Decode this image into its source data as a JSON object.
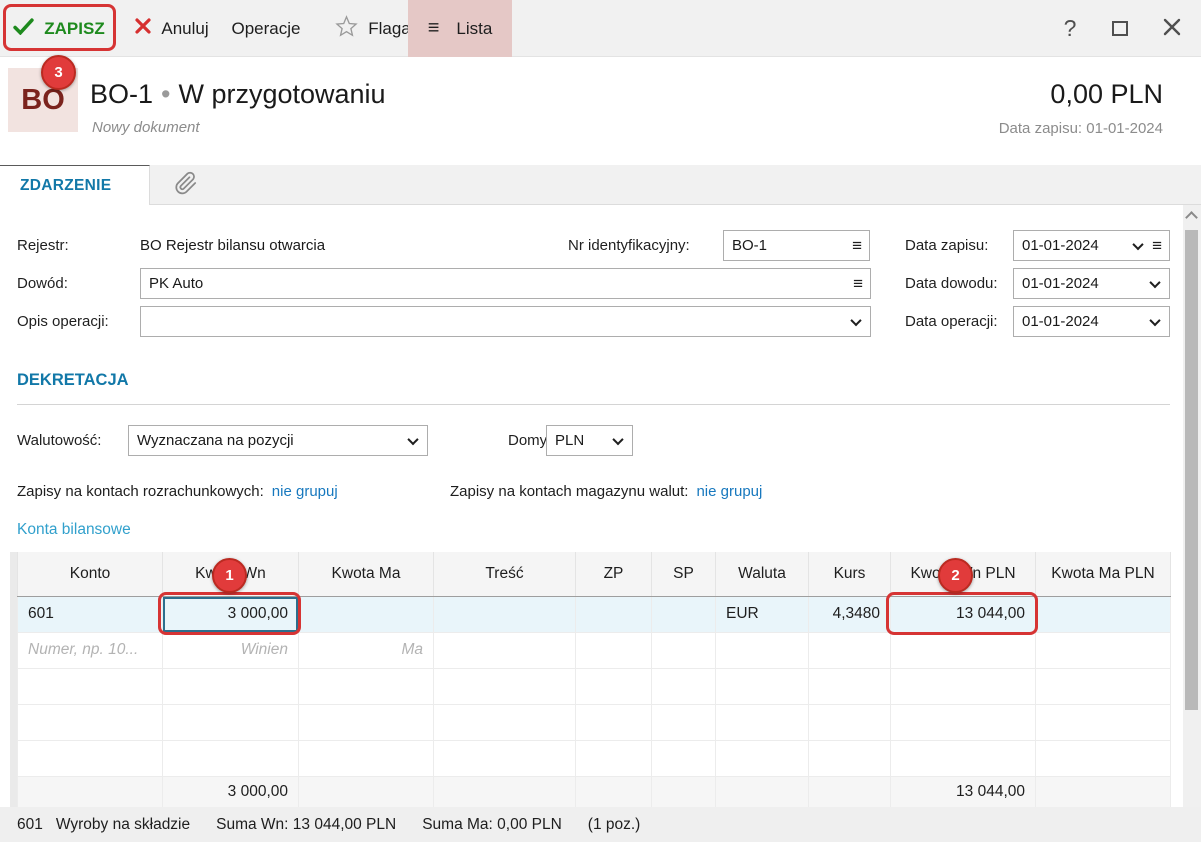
{
  "toolbar": {
    "zapisz": "ZAPISZ",
    "anuluj": "Anuluj",
    "operacje": "Operacje",
    "flaga": "Flaga",
    "lista": "Lista",
    "help": "?"
  },
  "header": {
    "badge": "BO",
    "doc_number": "BO-1",
    "separator": "•",
    "status": "W przygotowaniu",
    "subtitle": "Nowy dokument",
    "amount": "0,00 PLN",
    "save_date": "Data zapisu: 01-01-2024"
  },
  "tabs": {
    "zdarzenie": "ZDARZENIE"
  },
  "form": {
    "rejestr": {
      "label": "Rejestr:",
      "value": "BO Rejestr bilansu otwarcia"
    },
    "nr_identyfikacyjny": {
      "label": "Nr identyfikacyjny:",
      "value": "BO-1"
    },
    "data_zapisu": {
      "label": "Data zapisu:",
      "value": "01-01-2024"
    },
    "dowod": {
      "label": "Dowód:",
      "value": "PK Auto"
    },
    "data_dowodu": {
      "label": "Data dowodu:",
      "value": "01-01-2024"
    },
    "opis_operacji": {
      "label": "Opis operacji:",
      "value": ""
    },
    "data_operacji": {
      "label": "Data operacji:",
      "value": "01-01-2024"
    }
  },
  "dekretacja": {
    "title": "DEKRETACJA",
    "walutowosc": {
      "label": "Walutowość:",
      "value": "Wyznaczana na pozycji"
    },
    "domyslnie": {
      "label": "Domyślnie:",
      "value": "PLN"
    },
    "rozrachunkowe": {
      "label": "Zapisy na kontach rozrachunkowych:",
      "link": "nie grupuj"
    },
    "magazyn_walut": {
      "label": "Zapisy na kontach magazynu walut:",
      "link": "nie grupuj"
    },
    "konta_bilansowe": "Konta bilansowe"
  },
  "grid": {
    "columns": [
      "Konto",
      "Kwota Wn",
      "Kwota Ma",
      "Treść",
      "ZP",
      "SP",
      "Waluta",
      "Kurs",
      "Kwota Wn PLN",
      "Kwota Ma PLN"
    ],
    "row1": {
      "konto": "601",
      "kwota_wn": "3 000,00",
      "kwota_ma": "",
      "tresc": "",
      "zp": "",
      "sp": "",
      "waluta": "EUR",
      "kurs": "4,3480",
      "kwota_wn_pln": "13 044,00",
      "kwota_ma_pln": ""
    },
    "placeholder_row": {
      "konto": "Numer, np. 10...",
      "kwota_wn": "Winien",
      "kwota_ma": "Ma"
    },
    "sum_row": {
      "kwota_wn": "3 000,00",
      "kwota_wn_pln": "13 044,00"
    }
  },
  "statusbar": {
    "konto": "601",
    "konto_name": "Wyroby na składzie",
    "suma_wn": "Suma Wn: 13 044,00 PLN",
    "suma_ma": "Suma Ma: 0,00 PLN",
    "pozycje": "(1 poz.)"
  },
  "annotations": {
    "step1": "1",
    "step2": "2",
    "step3": "3"
  },
  "colors": {
    "accent_blue": "#1278a8",
    "link_blue": "#1778be",
    "annotation_red": "#d63434",
    "zapisz_green": "#1e8a1e",
    "lista_highlight": "#e5c8c6",
    "selected_row": "#e9f5fa"
  }
}
